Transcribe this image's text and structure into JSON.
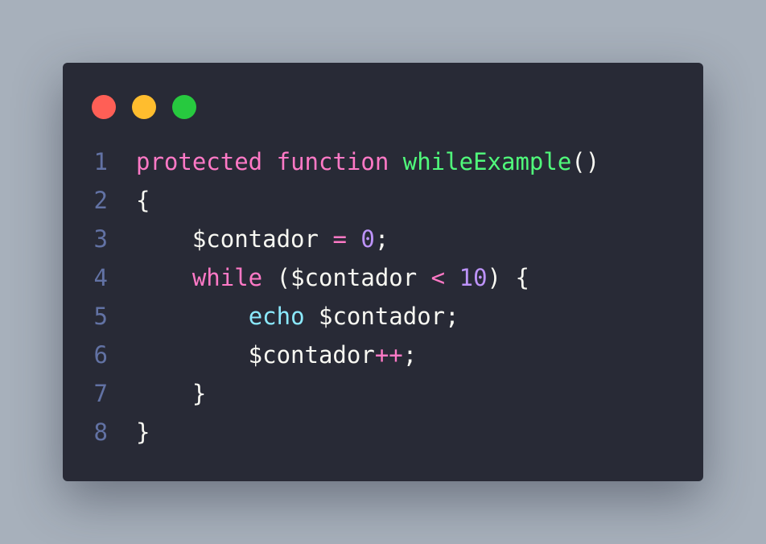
{
  "window": {
    "controls": [
      {
        "name": "close",
        "color": "#ff5f56"
      },
      {
        "name": "minimize",
        "color": "#ffbd2e"
      },
      {
        "name": "maximize",
        "color": "#27c93f"
      }
    ]
  },
  "code": {
    "lines": [
      {
        "num": "1",
        "tokens": [
          {
            "t": "protected",
            "k": "kw"
          },
          {
            "t": " ",
            "k": "pl"
          },
          {
            "t": "function",
            "k": "kw"
          },
          {
            "t": " ",
            "k": "pl"
          },
          {
            "t": "whileExample",
            "k": "fn"
          },
          {
            "t": "()",
            "k": "pl"
          }
        ]
      },
      {
        "num": "2",
        "tokens": [
          {
            "t": "{",
            "k": "pl"
          }
        ]
      },
      {
        "num": "3",
        "tokens": [
          {
            "t": "    $contador ",
            "k": "pl"
          },
          {
            "t": "=",
            "k": "op"
          },
          {
            "t": " ",
            "k": "pl"
          },
          {
            "t": "0",
            "k": "num"
          },
          {
            "t": ";",
            "k": "pl"
          }
        ]
      },
      {
        "num": "4",
        "tokens": [
          {
            "t": "    ",
            "k": "pl"
          },
          {
            "t": "while",
            "k": "kw"
          },
          {
            "t": " ($contador ",
            "k": "pl"
          },
          {
            "t": "<",
            "k": "op"
          },
          {
            "t": " ",
            "k": "pl"
          },
          {
            "t": "10",
            "k": "num"
          },
          {
            "t": ") {",
            "k": "pl"
          }
        ]
      },
      {
        "num": "5",
        "tokens": [
          {
            "t": "        ",
            "k": "pl"
          },
          {
            "t": "echo",
            "k": "bi"
          },
          {
            "t": " $contador;",
            "k": "pl"
          }
        ]
      },
      {
        "num": "6",
        "tokens": [
          {
            "t": "        $contador",
            "k": "pl"
          },
          {
            "t": "++",
            "k": "op"
          },
          {
            "t": ";",
            "k": "pl"
          }
        ]
      },
      {
        "num": "7",
        "tokens": [
          {
            "t": "    }",
            "k": "pl"
          }
        ]
      },
      {
        "num": "8",
        "tokens": [
          {
            "t": "}",
            "k": "pl"
          }
        ]
      }
    ]
  }
}
